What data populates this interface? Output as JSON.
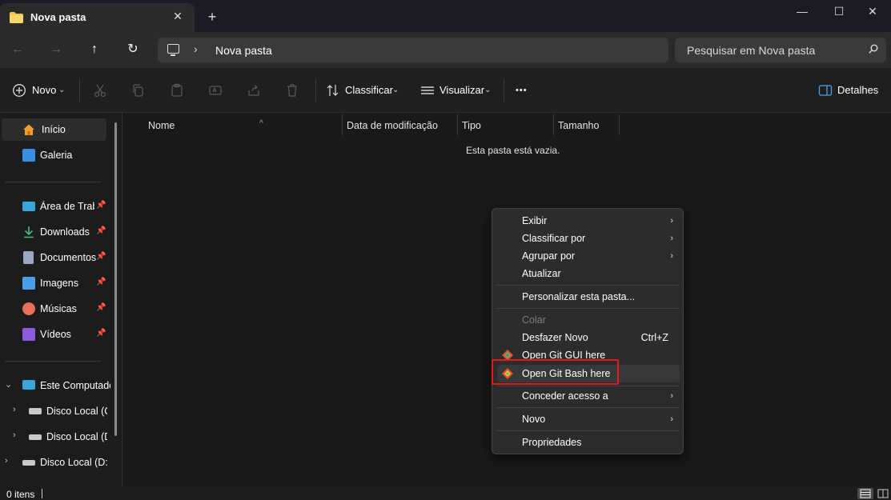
{
  "window": {
    "tab_title": "Nova pasta",
    "new_tab": "+",
    "minimize": "—",
    "maximize": "☐",
    "close": "✕",
    "tab_close": "✕"
  },
  "nav": {
    "back": "←",
    "forward": "→",
    "up": "↑",
    "refresh": "↻",
    "breadcrumb_sep": "›",
    "crumb": "Nova pasta",
    "search_placeholder": "Pesquisar em Nova pasta"
  },
  "toolbar": {
    "new_label": "Novo",
    "sort_label": "Classificar",
    "view_label": "Visualizar",
    "more": "•••",
    "details_label": "Detalhes",
    "caret": "⌄"
  },
  "sidebar": {
    "items": [
      {
        "label": "Início",
        "icon": "home-icon",
        "color": "#f0a030"
      },
      {
        "label": "Galeria",
        "icon": "gallery-icon",
        "color": "#3a8ee6"
      },
      {
        "label": "Área de Trabalho",
        "icon": "desktop-icon",
        "color": "#3aa6d8",
        "pin": "📌"
      },
      {
        "label": "Downloads",
        "icon": "downloads-icon",
        "color": "#3ec07a",
        "pin": "📌"
      },
      {
        "label": "Documentos",
        "icon": "documents-icon",
        "color": "#9aa8c8",
        "pin": "📌"
      },
      {
        "label": "Imagens",
        "icon": "pictures-icon",
        "color": "#4a9ee8",
        "pin": "📌"
      },
      {
        "label": "Músicas",
        "icon": "music-icon",
        "color": "#e8705a",
        "pin": "📌"
      },
      {
        "label": "Vídeos",
        "icon": "videos-icon",
        "color": "#8a5ce0",
        "pin": "📌"
      },
      {
        "label": "Este Computador",
        "icon": "computer-icon",
        "color": "#3aa6d8",
        "expand": "⌄"
      },
      {
        "label": "Disco Local (C:)",
        "icon": "drive-c-icon",
        "color": "#c8c8c8",
        "expand": "›"
      },
      {
        "label": "Disco Local (D:)",
        "icon": "drive-icon",
        "color": "#c8c8c8",
        "expand": "›"
      },
      {
        "label": "Disco Local (D:)",
        "icon": "drive-icon",
        "color": "#c8c8c8",
        "expand": "›"
      }
    ]
  },
  "columns": [
    "Nome",
    "Data de modificação",
    "Tipo",
    "Tamanho"
  ],
  "sort_caret": "^",
  "empty_message": "Esta pasta está vazia.",
  "context_menu": {
    "items": [
      {
        "label": "Exibir",
        "arrow": "›"
      },
      {
        "label": "Classificar por",
        "arrow": "›"
      },
      {
        "label": "Agrupar por",
        "arrow": "›"
      },
      {
        "label": "Atualizar"
      },
      {
        "label": "Personalizar esta pasta..."
      },
      {
        "label": "Colar",
        "disabled": true
      },
      {
        "label": "Desfazer Novo",
        "shortcut": "Ctrl+Z"
      },
      {
        "label": "Open Git GUI here",
        "icon": "git-gui-icon"
      },
      {
        "label": "Open Git Bash here",
        "icon": "git-bash-icon",
        "highlighted": true
      },
      {
        "label": "Conceder acesso a",
        "arrow": "›"
      },
      {
        "label": "Novo",
        "arrow": "›"
      },
      {
        "label": "Propriedades"
      }
    ]
  },
  "status": {
    "count": "0 itens"
  },
  "colors": {
    "accent_highlight": "#e31a1a",
    "folder": "#f4c542"
  }
}
